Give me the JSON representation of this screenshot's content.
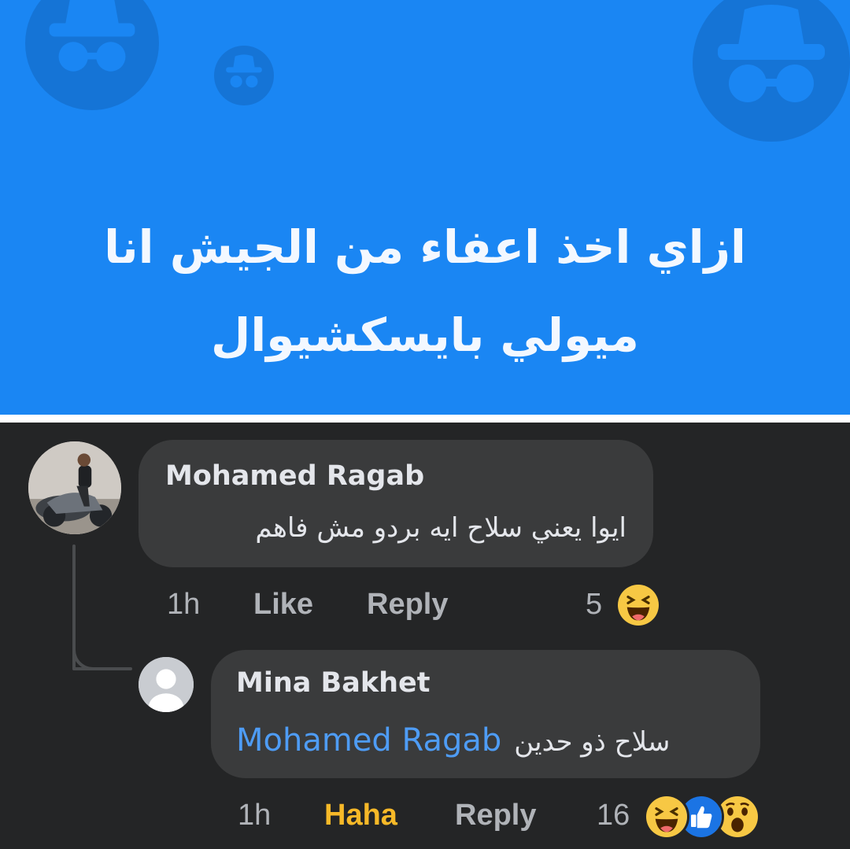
{
  "banner": {
    "line1": "ازاي اخذ اعفاء من الجيش انا",
    "line2": "ميولي بايسكشيوال",
    "bg_color": "#1a86f3",
    "icon": "anonymous-incognito-icon"
  },
  "comments": [
    {
      "author": "Mohamed Ragab",
      "text": "ايوا يعني سلاح ايه بردو مش فاهم",
      "time": "1h",
      "like_label": "Like",
      "reply_label": "Reply",
      "reaction_count": "5",
      "reactions": [
        "haha-emoji-icon"
      ],
      "avatar": "profile-photo-avatar"
    },
    {
      "author": "Mina Bakhet",
      "mention": "Mohamed Ragab",
      "text": "سلاح ذو حدين",
      "time": "1h",
      "reaction_label": "Haha",
      "reply_label": "Reply",
      "reaction_count": "16",
      "reactions": [
        "haha-emoji-icon",
        "like-emoji-icon",
        "wow-emoji-icon"
      ],
      "avatar": "default-user-avatar"
    }
  ],
  "colors": {
    "thread_bg": "#242526",
    "bubble_bg": "#3a3b3c",
    "mention": "#4e9cf5",
    "haha_active": "#f7b928"
  }
}
